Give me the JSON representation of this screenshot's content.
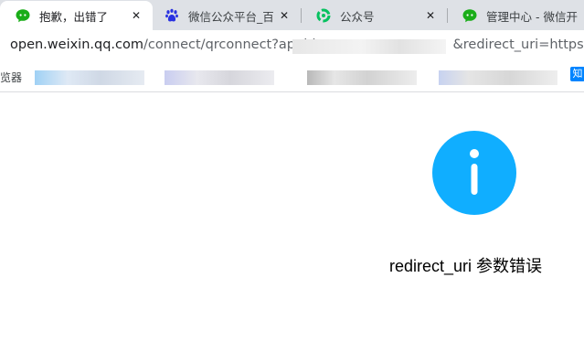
{
  "tabs": [
    {
      "title": "抱歉，出错了",
      "icon": "wechat-icon",
      "active": true
    },
    {
      "title": "微信公众平台_百度",
      "icon": "baidu-paw-icon",
      "active": false
    },
    {
      "title": "公众号",
      "icon": "green-swirl-icon",
      "active": false
    },
    {
      "title": "管理中心 - 微信开",
      "icon": "wechat-icon",
      "active": false
    }
  ],
  "close_glyph": "✕",
  "address": {
    "host": "open.weixin.qq.com",
    "path_visible": "/connect/qrconnect?appid",
    "suffix_visible": "&redirect_uri=https://w"
  },
  "bookmarks": {
    "leading_text": "览器",
    "last_icon_text": "知"
  },
  "main": {
    "message": "redirect_uri 参数错误",
    "icon": "info-icon",
    "icon_color": "#10aeff"
  },
  "colors": {
    "tabbar_bg": "#dee1e6",
    "wechat_green": "#1aad19",
    "baidu_blue": "#2932e1"
  }
}
